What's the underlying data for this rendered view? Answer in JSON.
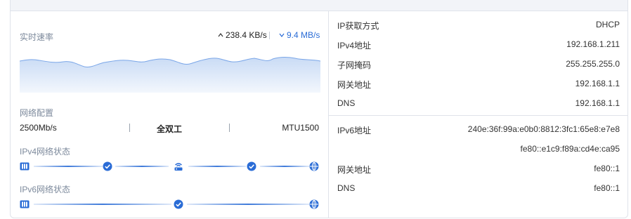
{
  "speed": {
    "label": "实时速率",
    "upload": "238.4 KB/s",
    "download": "9.4 MB/s"
  },
  "network_config": {
    "label": "网络配置",
    "bandwidth": "2500Mb/s",
    "duplex": "全双工",
    "mtu": "MTU1500"
  },
  "ipv4_status": {
    "label": "IPv4网络状态"
  },
  "ipv6_status": {
    "label": "IPv6网络状态"
  },
  "ipv4_info": [
    {
      "key": "IP获取方式",
      "value": "DHCP"
    },
    {
      "key": "IPv4地址",
      "value": "192.168.1.211"
    },
    {
      "key": "子网掩码",
      "value": "255.255.255.0"
    },
    {
      "key": "网关地址",
      "value": "192.168.1.1"
    },
    {
      "key": "DNS",
      "value": "192.168.1.1"
    }
  ],
  "ipv6_info": [
    {
      "key": "IPv6地址",
      "value": "240e:36f:99a:e0b0:8812:3fc1:65e8:e7e8"
    },
    {
      "key": "",
      "value": "fe80::e1c9:f89a:cd4e:ca95"
    },
    {
      "key": "网关地址",
      "value": "fe80::1"
    },
    {
      "key": "DNS",
      "value": "fe80::1"
    }
  ],
  "colors": {
    "accent": "#2a6cd6",
    "wave_fill": "#dbe7f8",
    "wave_stroke": "#7aa6e8"
  }
}
